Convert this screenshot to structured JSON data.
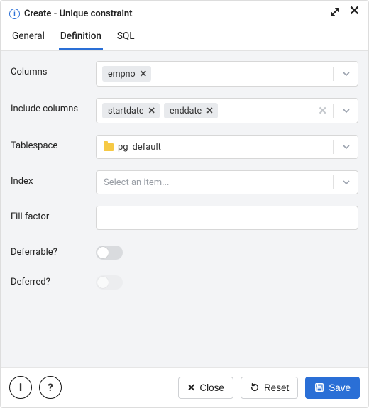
{
  "header": {
    "title": "Create - Unique constraint"
  },
  "tabs": {
    "general": "General",
    "definition": "Definition",
    "sql": "SQL"
  },
  "labels": {
    "columns": "Columns",
    "include_columns": "Include columns",
    "tablespace": "Tablespace",
    "index": "Index",
    "fill_factor": "Fill factor",
    "deferrable": "Deferrable?",
    "deferred": "Deferred?"
  },
  "form": {
    "columns": [
      "empno"
    ],
    "include_columns": [
      "startdate",
      "enddate"
    ],
    "tablespace": "pg_default",
    "index_placeholder": "Select an item...",
    "fill_factor": "",
    "deferrable": false,
    "deferred": false,
    "deferred_disabled": true
  },
  "footer": {
    "close": "Close",
    "reset": "Reset",
    "save": "Save"
  }
}
